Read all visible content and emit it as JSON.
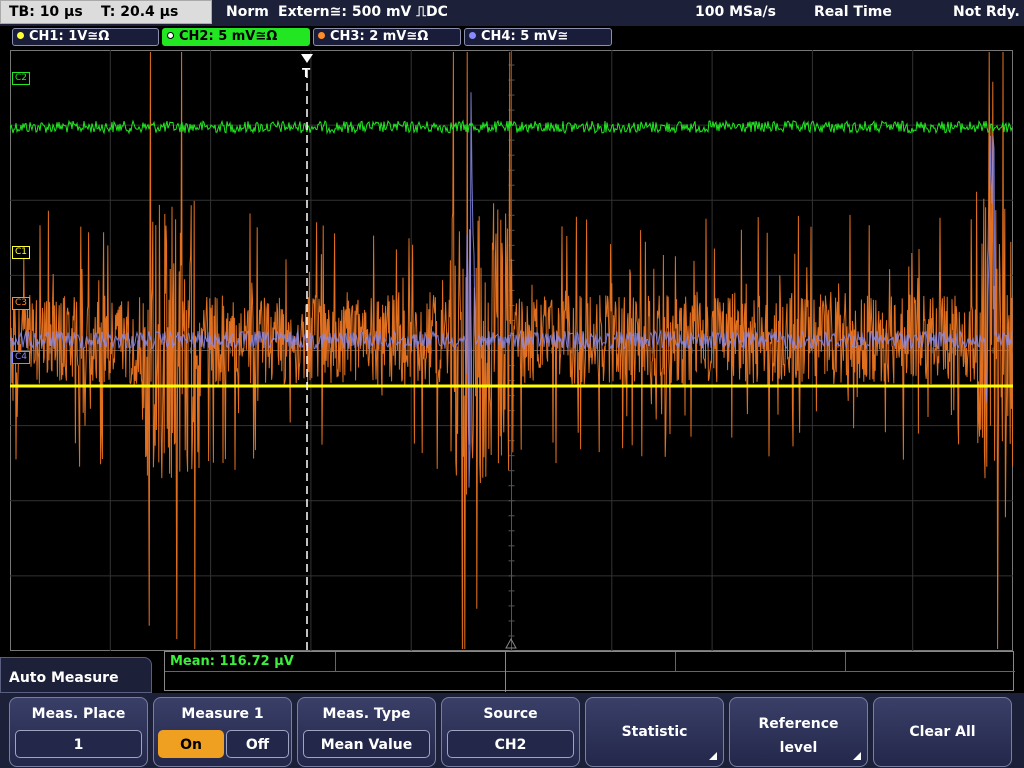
{
  "status": {
    "timebase": "TB: 10 µs",
    "trigger_time": "T: 20.4 µs",
    "mode": "Norm",
    "trigger_source": "Extern≅: 500 mV ⎍DC",
    "sample_rate": "100 MSa/s",
    "acq_mode": "Real Time",
    "state": "Not Rdy."
  },
  "channels": [
    {
      "label": "CH1: 1V≅Ω",
      "color": "#ffff33",
      "active": false
    },
    {
      "label": "CH2: 5 mV≅Ω",
      "color": "#22e622",
      "active": true
    },
    {
      "label": "CH3: 2 mV≅Ω",
      "color": "#ff8c2a",
      "active": false
    },
    {
      "label": "CH4: 5 mV≅",
      "color": "#8888ff",
      "active": false
    }
  ],
  "markers": {
    "c2": "C2",
    "c1": "C1",
    "c3": "C3",
    "c4": "C4",
    "trigger": "T"
  },
  "measurement": {
    "text": "Mean: 116.72 µV"
  },
  "menu": {
    "title": "Auto Measure",
    "softkeys": [
      {
        "label": "Meas. Place",
        "value": "1"
      },
      {
        "label": "Measure 1",
        "on": "On",
        "off": "Off",
        "selected": "On"
      },
      {
        "label": "Meas. Type",
        "value": "Mean Value"
      },
      {
        "label": "Source",
        "value": "CH2"
      },
      {
        "label": "Statistic"
      },
      {
        "label": "Reference level"
      },
      {
        "label": "Clear All"
      }
    ]
  }
}
